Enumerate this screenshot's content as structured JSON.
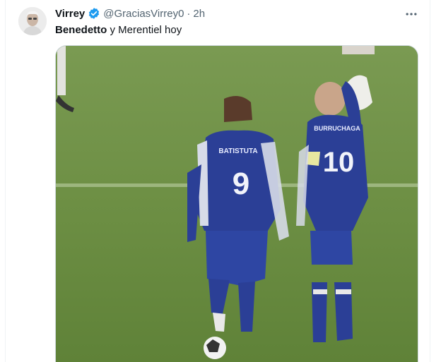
{
  "tweet": {
    "author": {
      "display_name": "Virrey",
      "handle": "@GraciasVirrey0",
      "verified": true
    },
    "separator": "·",
    "time": "2h",
    "text_bold": "Benedetto",
    "text_rest": " y Merentiel hoy",
    "media": {
      "type": "video",
      "players": [
        {
          "shirt_name": "BATISTUTA",
          "number": "9"
        },
        {
          "shirt_name": "BURRUCHAGA",
          "number": "10"
        }
      ]
    }
  },
  "colors": {
    "verified_badge": "#1d9bf0",
    "secondary_text": "#536471",
    "kit_blue": "#2b3f96",
    "pitch_green": "#6f9145"
  },
  "icons": {
    "verified": "verified-badge-icon",
    "more": "more-options-icon"
  }
}
